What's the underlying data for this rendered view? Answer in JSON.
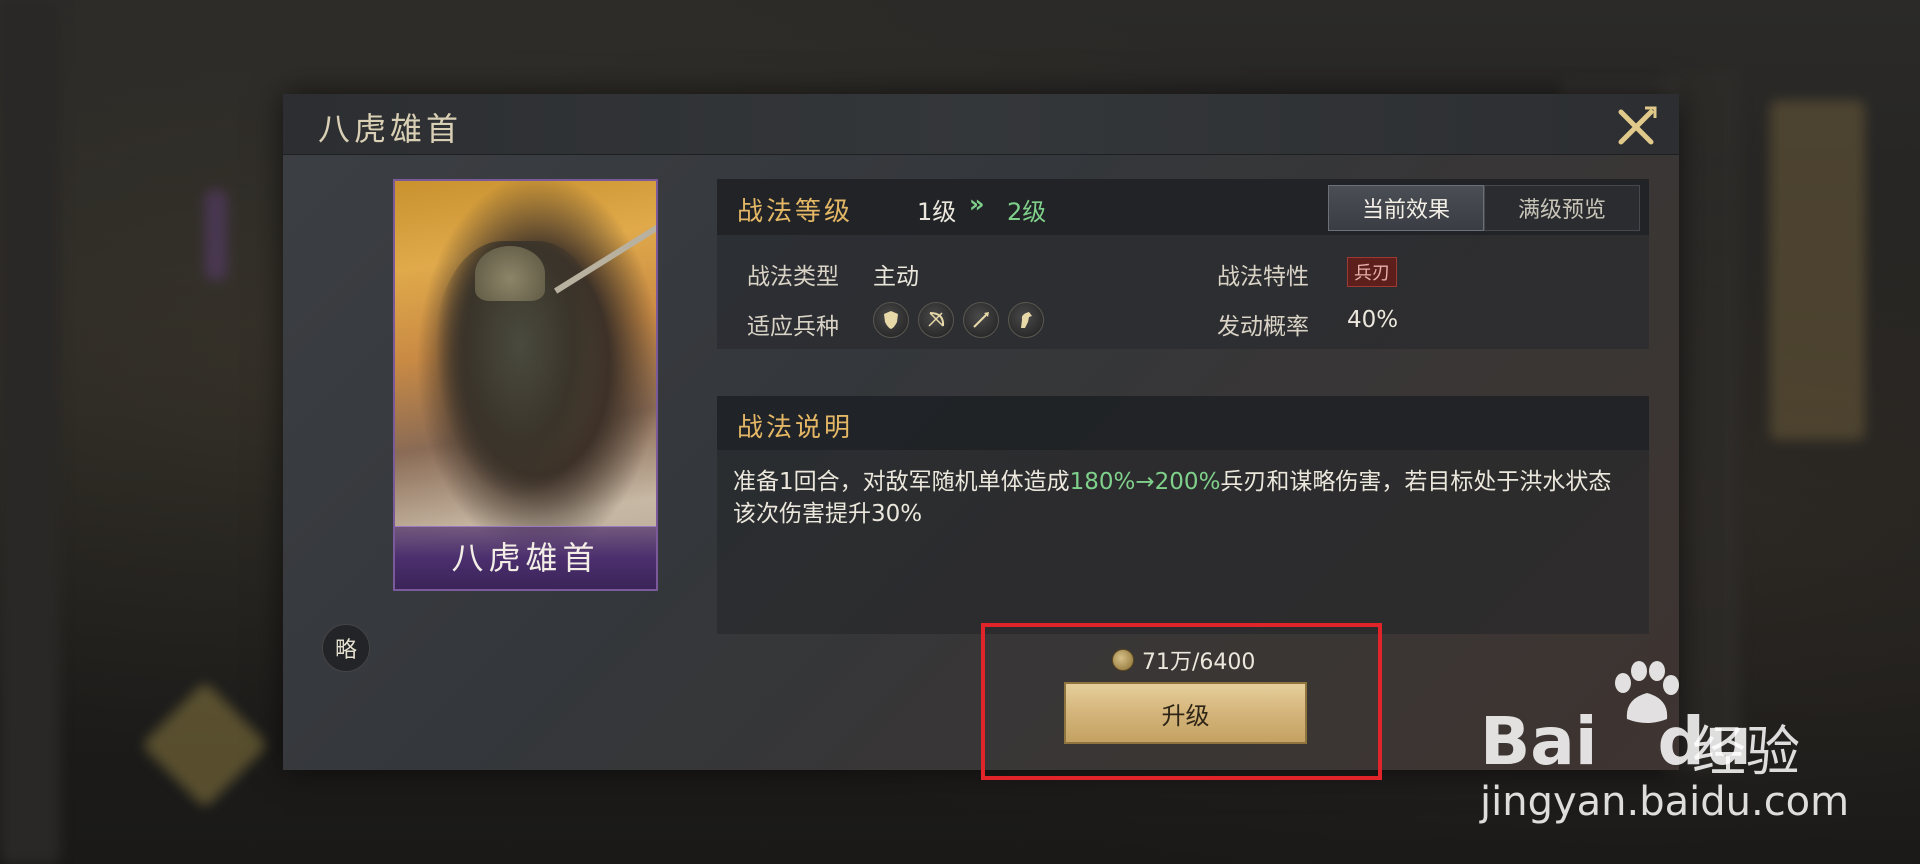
{
  "dialog": {
    "title": "八虎雄首",
    "close_label": "✕"
  },
  "card": {
    "name": "八虎雄首",
    "strategy_badge": "略"
  },
  "level": {
    "label": "战法等级",
    "current": "1级",
    "arrow": "»",
    "next": "2级"
  },
  "tabs": [
    {
      "label": "当前效果",
      "active": true
    },
    {
      "label": "满级预览",
      "active": false
    }
  ],
  "attributes": {
    "type_label": "战法类型",
    "type_value": "主动",
    "trait_label": "战法特性",
    "trait_value": "兵刃",
    "troops_label": "适应兵种",
    "troops": [
      "shield-icon",
      "bow-icon",
      "spear-icon",
      "horse-icon"
    ],
    "chance_label": "发动概率",
    "chance_value": "40%"
  },
  "description": {
    "title": "战法说明",
    "text_pre": "准备1回合，对敌军随机单体造成",
    "text_highlight": "180%→200%",
    "text_post": "兵刃和谋略伤害，若目标处于洪水状态该次伤害提升30%"
  },
  "upgrade": {
    "cost": "71万/6400",
    "button_label": "升级"
  },
  "watermark": {
    "main": "Bai",
    "du": "du",
    "cn": "经验",
    "url": "jingyan.baidu.com"
  },
  "colors": {
    "accent_gold": "#e3b765",
    "highlight_green": "#7fd08a",
    "annotation_red": "#e0242a"
  }
}
